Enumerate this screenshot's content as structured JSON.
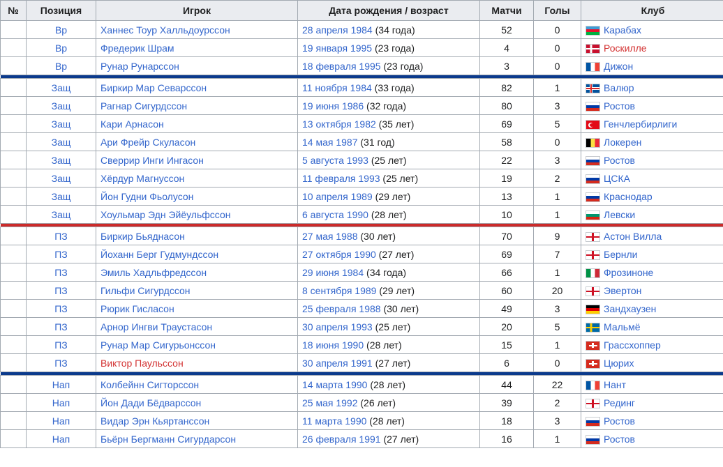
{
  "headers": {
    "num": "№",
    "pos": "Позиция",
    "player": "Игрок",
    "dob": "Дата рождения / возраст",
    "caps": "Матчи",
    "goals": "Голы",
    "club": "Клуб"
  },
  "colors": {
    "link": "#3366cc",
    "redlink": "#d33333",
    "sep_gk": "#0b3a8c",
    "sep_df": "#cc2a2a",
    "sep_mf": "#0b3a8c"
  },
  "groups": [
    {
      "separator_after": "sep_gk",
      "rows": [
        {
          "num": "",
          "pos": "Вр",
          "player": "Ханнес Тоур Халльдоурссон",
          "player_red": false,
          "date": "28 апреля 1984",
          "age": " (34 года)",
          "caps": "52",
          "goals": "0",
          "flag": "azerbaijan",
          "club": "Карабах",
          "club_red": false
        },
        {
          "num": "",
          "pos": "Вр",
          "player": "Фредерик Шрам",
          "player_red": false,
          "date": "19 января 1995",
          "age": " (23 года)",
          "caps": "4",
          "goals": "0",
          "flag": "denmark",
          "club": "Роскилле",
          "club_red": true
        },
        {
          "num": "",
          "pos": "Вр",
          "player": "Рунар Рунарссон",
          "player_red": false,
          "date": "18 февраля 1995",
          "age": " (23 года)",
          "caps": "3",
          "goals": "0",
          "flag": "france",
          "club": "Дижон",
          "club_red": false
        }
      ]
    },
    {
      "separator_after": "sep_df",
      "rows": [
        {
          "num": "",
          "pos": "Защ",
          "player": "Биркир Мар Севарссон",
          "player_red": false,
          "date": "11 ноября 1984",
          "age": " (33 года)",
          "caps": "82",
          "goals": "1",
          "flag": "iceland",
          "club": "Валюр",
          "club_red": false
        },
        {
          "num": "",
          "pos": "Защ",
          "player": "Рагнар Сигурдссон",
          "player_red": false,
          "date": "19 июня 1986",
          "age": " (32 года)",
          "caps": "80",
          "goals": "3",
          "flag": "russia",
          "club": "Ростов",
          "club_red": false
        },
        {
          "num": "",
          "pos": "Защ",
          "player": "Кари Арнасон",
          "player_red": false,
          "date": "13 октября 1982",
          "age": " (35 лет)",
          "caps": "69",
          "goals": "5",
          "flag": "turkey",
          "club": "Генчлербирлиги",
          "club_red": false
        },
        {
          "num": "",
          "pos": "Защ",
          "player": "Ари Фрейр Скуласон",
          "player_red": false,
          "date": "14 мая 1987",
          "age": " (31 год)",
          "caps": "58",
          "goals": "0",
          "flag": "belgium",
          "club": "Локерен",
          "club_red": false
        },
        {
          "num": "",
          "pos": "Защ",
          "player": "Сверрир Инги Ингасон",
          "player_red": false,
          "date": "5 августа 1993",
          "age": " (25 лет)",
          "caps": "22",
          "goals": "3",
          "flag": "russia",
          "club": "Ростов",
          "club_red": false
        },
        {
          "num": "",
          "pos": "Защ",
          "player": "Хёрдур Магнуссон",
          "player_red": false,
          "date": "11 февраля 1993",
          "age": " (25 лет)",
          "caps": "19",
          "goals": "2",
          "flag": "russia",
          "club": "ЦСКА",
          "club_red": false
        },
        {
          "num": "",
          "pos": "Защ",
          "player": "Йон Гудни Фьолусон",
          "player_red": false,
          "date": "10 апреля 1989",
          "age": " (29 лет)",
          "caps": "13",
          "goals": "1",
          "flag": "russia",
          "club": "Краснодар",
          "club_red": false
        },
        {
          "num": "",
          "pos": "Защ",
          "player": "Хоульмар Эдн Эйёульфссон",
          "player_red": false,
          "date": "6 августа 1990",
          "age": " (28 лет)",
          "caps": "10",
          "goals": "1",
          "flag": "bulgaria",
          "club": "Левски",
          "club_red": false
        }
      ]
    },
    {
      "separator_after": "sep_mf",
      "rows": [
        {
          "num": "",
          "pos": "ПЗ",
          "player": "Биркир Бьяднасон",
          "player_red": false,
          "date": "27 мая 1988",
          "age": " (30 лет)",
          "caps": "70",
          "goals": "9",
          "flag": "england",
          "club": "Астон Вилла",
          "club_red": false
        },
        {
          "num": "",
          "pos": "ПЗ",
          "player": "Йоханн Берг Гудмундссон",
          "player_red": false,
          "date": "27 октября 1990",
          "age": " (27 лет)",
          "caps": "69",
          "goals": "7",
          "flag": "england",
          "club": "Бернли",
          "club_red": false
        },
        {
          "num": "",
          "pos": "ПЗ",
          "player": "Эмиль Хадльфредссон",
          "player_red": false,
          "date": "29 июня 1984",
          "age": " (34 года)",
          "caps": "66",
          "goals": "1",
          "flag": "italy",
          "club": "Фрозиноне",
          "club_red": false
        },
        {
          "num": "",
          "pos": "ПЗ",
          "player": "Гильфи Сигурдссон",
          "player_red": false,
          "date": "8 сентября 1989",
          "age": " (29 лет)",
          "caps": "60",
          "goals": "20",
          "flag": "england",
          "club": "Эвертон",
          "club_red": false
        },
        {
          "num": "",
          "pos": "ПЗ",
          "player": "Рюрик Гисласон",
          "player_red": false,
          "date": "25 февраля 1988",
          "age": " (30 лет)",
          "caps": "49",
          "goals": "3",
          "flag": "germany",
          "club": "Зандхаузен",
          "club_red": false
        },
        {
          "num": "",
          "pos": "ПЗ",
          "player": "Арнор Ингви Траустасон",
          "player_red": false,
          "date": "30 апреля 1993",
          "age": " (25 лет)",
          "caps": "20",
          "goals": "5",
          "flag": "sweden",
          "club": "Мальмё",
          "club_red": false
        },
        {
          "num": "",
          "pos": "ПЗ",
          "player": "Рунар Мар Сигурьонссон",
          "player_red": false,
          "date": "18 июня 1990",
          "age": " (28 лет)",
          "caps": "15",
          "goals": "1",
          "flag": "switzerland",
          "club": "Грассхоппер",
          "club_red": false
        },
        {
          "num": "",
          "pos": "ПЗ",
          "player": "Виктор Паульссон",
          "player_red": true,
          "date": "30 апреля 1991",
          "age": " (27 лет)",
          "caps": "6",
          "goals": "0",
          "flag": "switzerland",
          "club": "Цюрих",
          "club_red": false
        }
      ]
    },
    {
      "separator_after": null,
      "rows": [
        {
          "num": "",
          "pos": "Нап",
          "player": "Колбейнн Сигторссон",
          "player_red": false,
          "date": "14 марта 1990",
          "age": " (28 лет)",
          "caps": "44",
          "goals": "22",
          "flag": "france",
          "club": "Нант",
          "club_red": false
        },
        {
          "num": "",
          "pos": "Нап",
          "player": "Йон Дади Бёдварссон",
          "player_red": false,
          "date": "25 мая 1992",
          "age": " (26 лет)",
          "caps": "39",
          "goals": "2",
          "flag": "england",
          "club": "Рединг",
          "club_red": false
        },
        {
          "num": "",
          "pos": "Нап",
          "player": "Видар Эрн Кьяртанссон",
          "player_red": false,
          "date": "11 марта 1990",
          "age": " (28 лет)",
          "caps": "18",
          "goals": "3",
          "flag": "russia",
          "club": "Ростов",
          "club_red": false
        },
        {
          "num": "",
          "pos": "Нап",
          "player": "Бьёрн Бергманн Сигурдарсон",
          "player_red": false,
          "date": "26 февраля 1991",
          "age": " (27 лет)",
          "caps": "16",
          "goals": "1",
          "flag": "russia",
          "club": "Ростов",
          "club_red": false
        }
      ]
    }
  ]
}
